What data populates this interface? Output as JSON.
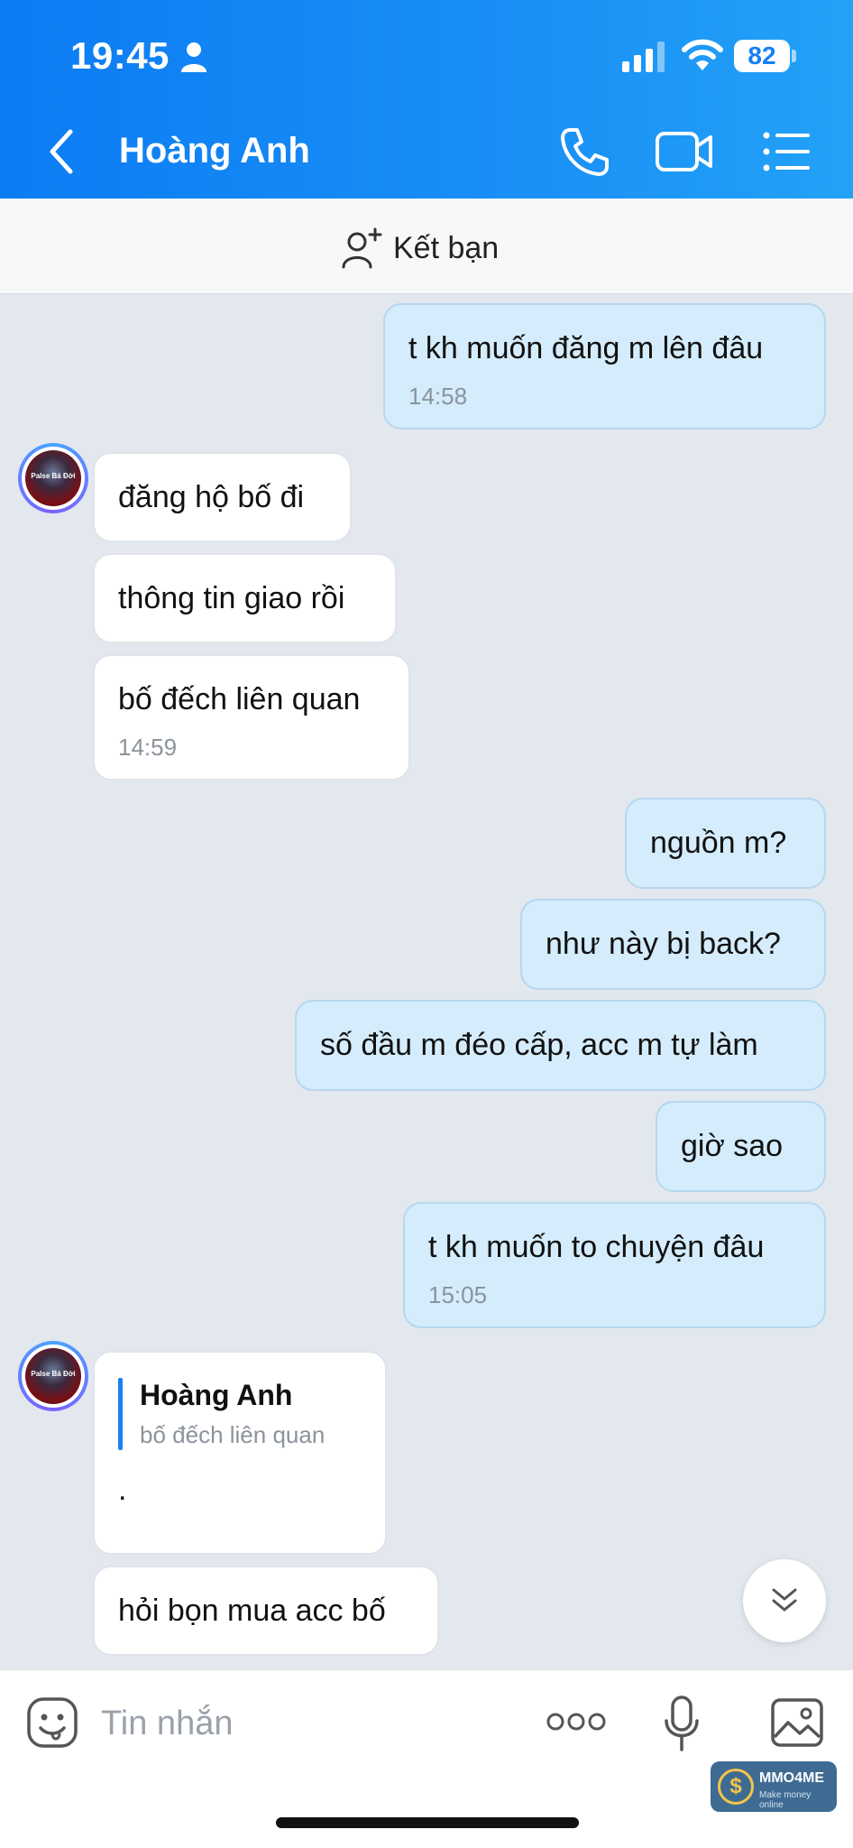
{
  "status_bar": {
    "time": "19:45",
    "battery": "82"
  },
  "header": {
    "title": "Hoàng Anh"
  },
  "friend_bar": {
    "label": "Kết bạn"
  },
  "messages": [
    {
      "dir": "out",
      "text": "t kh muốn đăng m lên đâu",
      "time": "14:58"
    },
    {
      "dir": "in",
      "text": "đăng hộ bố đi"
    },
    {
      "dir": "in",
      "text": "thông tin giao rồi"
    },
    {
      "dir": "in",
      "text": "bố đếch liên quan",
      "time": "14:59"
    },
    {
      "dir": "out",
      "text": "nguồn m?"
    },
    {
      "dir": "out",
      "text": "như này bị back?"
    },
    {
      "dir": "out",
      "text": "số đầu m đéo cấp, acc m tự làm"
    },
    {
      "dir": "out",
      "text": "giờ sao"
    },
    {
      "dir": "out",
      "text": "t kh muốn to chuyện đâu",
      "time": "15:05"
    },
    {
      "dir": "in",
      "quote_name": "Hoàng Anh",
      "quote_text": "bố đếch liên quan",
      "text": "."
    },
    {
      "dir": "in",
      "text": "hỏi bọn mua acc bố"
    }
  ],
  "avatar": {
    "caption": "Palse Bá Đời"
  },
  "input": {
    "placeholder": "Tin nhắn"
  },
  "watermark": {
    "title": "MMO4ME",
    "subtitle": "Make money online",
    "coin": "$"
  },
  "colors": {
    "header_start": "#0c7cf3",
    "header_end": "#22a2f7",
    "outgoing_bubble": "#d4ecfb",
    "incoming_bubble": "#ffffff",
    "chat_bg": "#e3e8ef"
  }
}
